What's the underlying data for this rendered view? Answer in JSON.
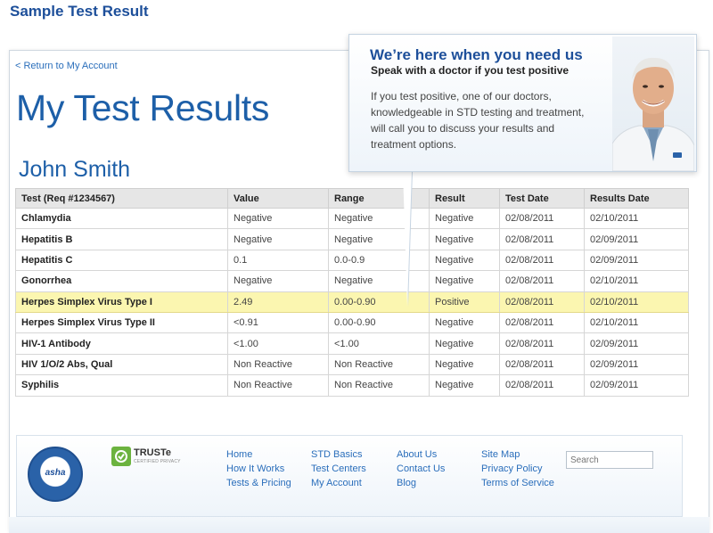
{
  "window": {
    "title": "Sample Test Result"
  },
  "nav": {
    "back_link": "< Return to My Account"
  },
  "page": {
    "title": "My Test Results",
    "patient_name": "John Smith"
  },
  "callout": {
    "heading": "We’re here when you need us",
    "subheading": "Speak with a doctor if you test positive",
    "body": "If you test positive, one of our doctors, knowledgeable in STD testing and treatment, will call you to discuss your results and treatment options."
  },
  "results": {
    "columns": [
      "Test (Req #1234567)",
      "Value",
      "Range",
      "Result",
      "Test Date",
      "Results Date"
    ],
    "rows": [
      [
        "Chlamydia",
        "Negative",
        "Negative",
        "Negative",
        "02/08/2011",
        "02/10/2011"
      ],
      [
        "Hepatitis B",
        "Negative",
        "Negative",
        "Negative",
        "02/08/2011",
        "02/09/2011"
      ],
      [
        "Hepatitis C",
        "0.1",
        "0.0-0.9",
        "Negative",
        "02/08/2011",
        "02/09/2011"
      ],
      [
        "Gonorrhea",
        "Negative",
        "Negative",
        "Negative",
        "02/08/2011",
        "02/10/2011"
      ],
      [
        "Herpes Simplex Virus Type I",
        "2.49",
        "0.00-0.90",
        "Positive",
        "02/08/2011",
        "02/10/2011"
      ],
      [
        "Herpes Simplex Virus Type II",
        "<0.91",
        "0.00-0.90",
        "Negative",
        "02/08/2011",
        "02/10/2011"
      ],
      [
        "HIV-1 Antibody",
        "<1.00",
        "<1.00",
        "Negative",
        "02/08/2011",
        "02/09/2011"
      ],
      [
        "HIV 1/O/2 Abs, Qual",
        "Non Reactive",
        "Non Reactive",
        "Negative",
        "02/08/2011",
        "02/09/2011"
      ],
      [
        "Syphilis",
        "Non Reactive",
        "Non Reactive",
        "Negative",
        "02/08/2011",
        "02/09/2011"
      ]
    ],
    "highlight_row": 4,
    "highlight_color": "#fbf6b0"
  },
  "footer": {
    "seal_text": "asha",
    "seal_icon": "verified-seal-icon",
    "truste_label": "TRUSTe",
    "truste_sub": "CERTIFIED PRIVACY",
    "links_col1": [
      "Home",
      "How It Works",
      "Tests & Pricing"
    ],
    "links_col2": [
      "STD Basics",
      "Test Centers",
      "My Account"
    ],
    "links_col3": [
      "About Us",
      "Contact Us",
      "Blog"
    ],
    "links_col4": [
      "Site Map",
      "Privacy Policy",
      "Terms of Service"
    ],
    "search_placeholder": "Search"
  },
  "colors": {
    "brand_blue": "#1d5fa8",
    "link_blue": "#2a6ebb",
    "truste_green": "#6cb33f"
  }
}
